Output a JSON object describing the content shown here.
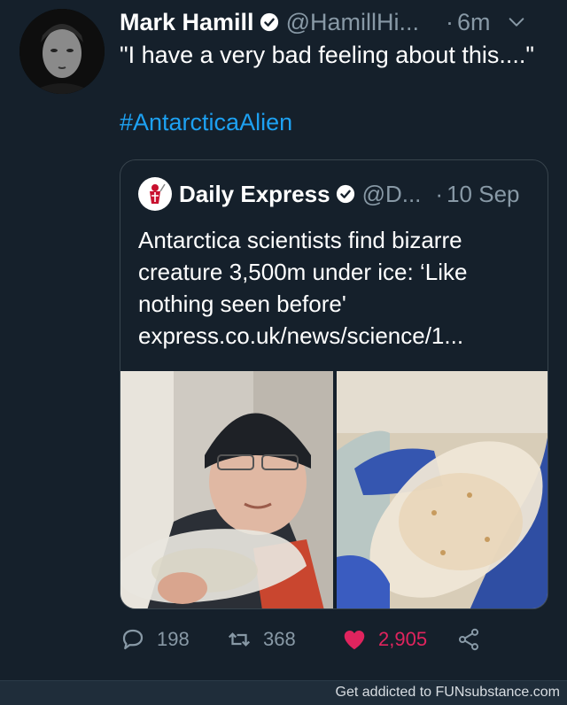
{
  "tweet": {
    "author": {
      "display_name": "Mark Hamill",
      "handle": "@HamillHi...",
      "verified": true
    },
    "separator": "·",
    "time": "6m",
    "text": "\"I have a very bad feeling about this....\"",
    "hashtag": "#AntarcticaAlien",
    "menu_icon": "chevron-down-icon"
  },
  "quote": {
    "author": {
      "display_name": "Daily Express",
      "handle": "@D...",
      "verified": true
    },
    "separator": "·",
    "date": "10 Sep",
    "text": "Antarctica scientists find bizarre creature 3,500m under ice: ‘Like nothing seen before'",
    "link": "express.co.uk/news/science/1..."
  },
  "actions": {
    "reply_count": "198",
    "retweet_count": "368",
    "like_count": "2,905",
    "like_active": true,
    "like_color": "#e0245e"
  },
  "footer": {
    "watermark": "Get addicted to FUNsubstance.com"
  },
  "colors": {
    "background": "#15202b",
    "secondary_text": "#8899a6",
    "link": "#1da1f2",
    "border": "#38444d"
  }
}
